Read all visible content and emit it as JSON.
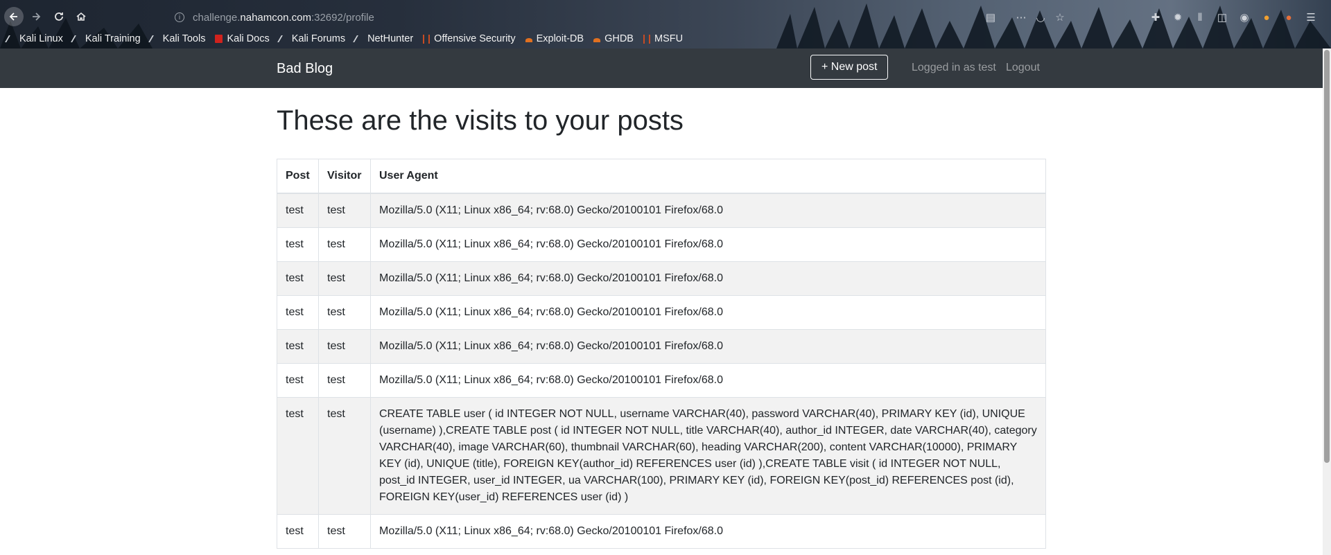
{
  "browser": {
    "url_prefix": "challenge.",
    "url_host": "nahamcon.com",
    "url_suffix": ":32692/profile",
    "bookmarks": [
      {
        "label": "Kali Linux",
        "icon": "kali-dragon-icon"
      },
      {
        "label": "Kali Training",
        "icon": "kali-dragon-icon"
      },
      {
        "label": "Kali Tools",
        "icon": "kali-dragon-icon"
      },
      {
        "label": "Kali Docs",
        "icon": "kali-docs-icon"
      },
      {
        "label": "Kali Forums",
        "icon": "kali-dragon-icon"
      },
      {
        "label": "NetHunter",
        "icon": "kali-dragon-icon"
      },
      {
        "label": "Offensive Security",
        "icon": "offsec-icon"
      },
      {
        "label": "Exploit-DB",
        "icon": "exploitdb-icon"
      },
      {
        "label": "GHDB",
        "icon": "exploitdb-icon"
      },
      {
        "label": "MSFU",
        "icon": "offsec-icon"
      }
    ]
  },
  "navbar": {
    "brand": "Bad Blog",
    "new_post": "+ New post",
    "logged_in": "Logged in as test",
    "logout": "Logout"
  },
  "page": {
    "heading": "These are the visits to your posts"
  },
  "table": {
    "headers": [
      "Post",
      "Visitor",
      "User Agent"
    ],
    "rows": [
      [
        "test",
        "test",
        "Mozilla/5.0 (X11; Linux x86_64; rv:68.0) Gecko/20100101 Firefox/68.0"
      ],
      [
        "test",
        "test",
        "Mozilla/5.0 (X11; Linux x86_64; rv:68.0) Gecko/20100101 Firefox/68.0"
      ],
      [
        "test",
        "test",
        "Mozilla/5.0 (X11; Linux x86_64; rv:68.0) Gecko/20100101 Firefox/68.0"
      ],
      [
        "test",
        "test",
        "Mozilla/5.0 (X11; Linux x86_64; rv:68.0) Gecko/20100101 Firefox/68.0"
      ],
      [
        "test",
        "test",
        "Mozilla/5.0 (X11; Linux x86_64; rv:68.0) Gecko/20100101 Firefox/68.0"
      ],
      [
        "test",
        "test",
        "Mozilla/5.0 (X11; Linux x86_64; rv:68.0) Gecko/20100101 Firefox/68.0"
      ],
      [
        "test",
        "test",
        "CREATE TABLE user ( id INTEGER NOT NULL, username VARCHAR(40), password VARCHAR(40), PRIMARY KEY (id), UNIQUE (username) ),CREATE TABLE post ( id INTEGER NOT NULL, title VARCHAR(40), author_id INTEGER, date VARCHAR(40), category VARCHAR(40), image VARCHAR(60), thumbnail VARCHAR(60), heading VARCHAR(200), content VARCHAR(10000), PRIMARY KEY (id), UNIQUE (title), FOREIGN KEY(author_id) REFERENCES user (id) ),CREATE TABLE visit ( id INTEGER NOT NULL, post_id INTEGER, user_id INTEGER, ua VARCHAR(100), PRIMARY KEY (id), FOREIGN KEY(post_id) REFERENCES post (id), FOREIGN KEY(user_id) REFERENCES user (id) )"
      ],
      [
        "test",
        "test",
        "Mozilla/5.0 (X11; Linux x86_64; rv:68.0) Gecko/20100101 Firefox/68.0"
      ]
    ]
  }
}
